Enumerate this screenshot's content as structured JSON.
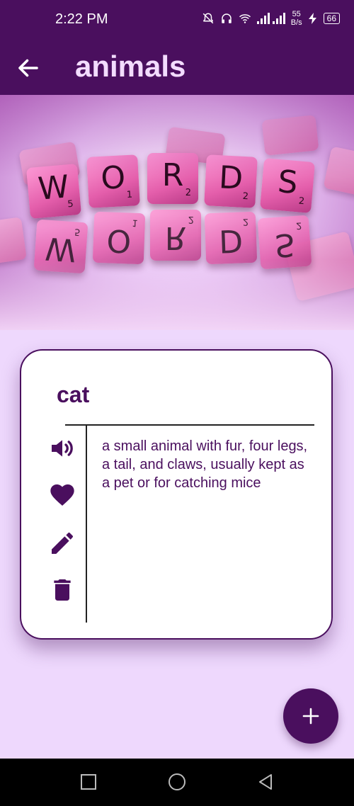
{
  "status_bar": {
    "time": "2:22 PM",
    "netspeed_value": "55",
    "netspeed_unit": "B/s",
    "battery": "66"
  },
  "app_bar": {
    "title": "animals",
    "back_icon": "arrow-left-icon"
  },
  "hero": {
    "tiles": [
      {
        "letter": "W",
        "number": "5"
      },
      {
        "letter": "O",
        "number": "1"
      },
      {
        "letter": "R",
        "number": "2"
      },
      {
        "letter": "D",
        "number": "2"
      },
      {
        "letter": "S",
        "number": "2"
      }
    ]
  },
  "word_card": {
    "word": "cat",
    "definition": "a small animal with fur, four legs, a tail, and claws, usually kept as a pet or for catching mice",
    "actions": [
      "speaker-icon",
      "heart-icon",
      "pencil-icon",
      "trash-icon"
    ]
  },
  "fab": {
    "icon": "plus-icon"
  },
  "nav_bar": {
    "buttons": [
      "square-icon",
      "circle-icon",
      "triangle-back-icon"
    ]
  },
  "colors": {
    "primary": "#4a0f5e",
    "background": "#eed8fd",
    "card": "#ffffff"
  }
}
